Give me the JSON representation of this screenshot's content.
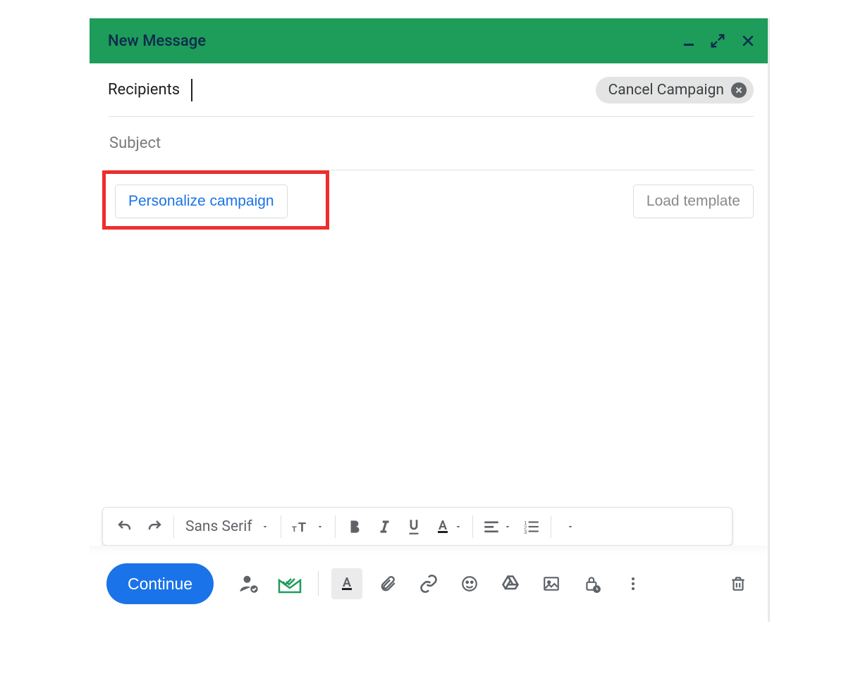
{
  "titlebar": {
    "title": "New Message"
  },
  "recipients": {
    "label": "Recipients"
  },
  "chip": {
    "label": "Cancel Campaign"
  },
  "subject": {
    "placeholder": "Subject",
    "value": ""
  },
  "body_actions": {
    "personalize_label": "Personalize campaign",
    "load_template_label": "Load template"
  },
  "format_toolbar": {
    "font_label": "Sans Serif"
  },
  "bottom_toolbar": {
    "send_label": "Continue"
  }
}
